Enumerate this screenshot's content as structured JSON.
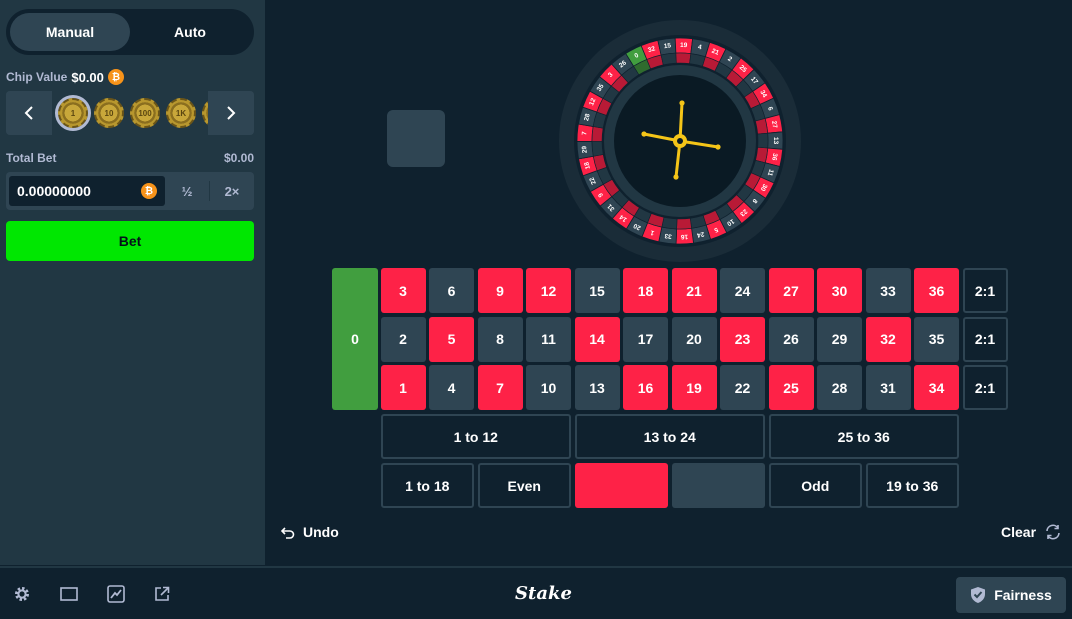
{
  "sidebar": {
    "modes": [
      {
        "label": "Manual",
        "active": true
      },
      {
        "label": "Auto",
        "active": false
      }
    ],
    "chip_value_label": "Chip Value",
    "chip_value": "$0.00",
    "chips": [
      "1",
      "10",
      "100",
      "1K"
    ],
    "total_bet_label": "Total Bet",
    "total_bet_usd": "$0.00",
    "bet_amount": "0.00000000",
    "half_label": "½",
    "double_label": "2×",
    "bet_button": "Bet",
    "btc_symbol": "₿"
  },
  "board": {
    "zero": "0",
    "rows": [
      [
        "3",
        "6",
        "9",
        "12",
        "15",
        "18",
        "21",
        "24",
        "27",
        "30",
        "33",
        "36"
      ],
      [
        "2",
        "5",
        "8",
        "11",
        "14",
        "17",
        "20",
        "23",
        "26",
        "29",
        "32",
        "35"
      ],
      [
        "1",
        "4",
        "7",
        "10",
        "13",
        "16",
        "19",
        "22",
        "25",
        "28",
        "31",
        "34"
      ]
    ],
    "red_numbers": [
      "1",
      "3",
      "5",
      "7",
      "9",
      "12",
      "14",
      "16",
      "18",
      "19",
      "21",
      "23",
      "25",
      "27",
      "30",
      "32",
      "34",
      "36"
    ],
    "column_bets": [
      "2:1",
      "2:1",
      "2:1"
    ],
    "dozens": [
      "1 to 12",
      "13 to 24",
      "25 to 36"
    ],
    "outside": [
      "1 to 18",
      "Even",
      "",
      "",
      "Odd",
      "19 to 36"
    ]
  },
  "wheel": {
    "pockets": [
      "0",
      "32",
      "15",
      "19",
      "4",
      "21",
      "2",
      "25",
      "17",
      "34",
      "6",
      "27",
      "13",
      "36",
      "11",
      "30",
      "8",
      "23",
      "10",
      "5",
      "24",
      "16",
      "33",
      "1",
      "20",
      "14",
      "31",
      "9",
      "22",
      "18",
      "29",
      "7",
      "28",
      "12",
      "35",
      "3",
      "26"
    ]
  },
  "controls": {
    "undo": "Undo",
    "clear": "Clear"
  },
  "footer": {
    "logo": "Stake",
    "fairness": "Fairness"
  },
  "colors": {
    "red": "#fe2247",
    "black": "#2f4553",
    "green": "#419e3f",
    "bet_green": "#00e701",
    "background": "#0f212e",
    "panel": "#213743",
    "hub_gold": "#f5c518"
  }
}
